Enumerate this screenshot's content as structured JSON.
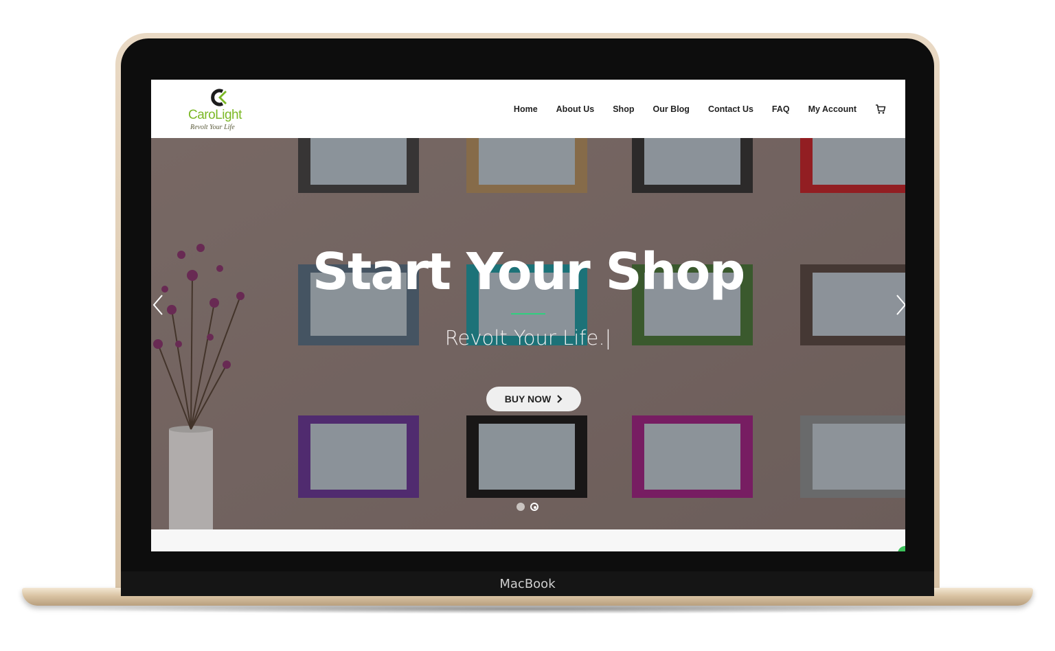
{
  "device": {
    "label": "MacBook"
  },
  "site": {
    "logo": {
      "name": "CaroLight",
      "tagline": "Revolt Your Life",
      "color": "#7bb824"
    },
    "nav": [
      {
        "label": "Home"
      },
      {
        "label": "About Us"
      },
      {
        "label": "Shop"
      },
      {
        "label": "Our Blog"
      },
      {
        "label": "Contact Us"
      },
      {
        "label": "FAQ"
      },
      {
        "label": "My Account"
      }
    ],
    "cart_icon": "cart-icon"
  },
  "hero": {
    "title": "Start Your Shop",
    "subtitle": "Revolt Your Life.|",
    "button_label": "BUY NOW",
    "accent_color": "#2fd07f",
    "slides": {
      "count": 2,
      "active": 2
    }
  }
}
